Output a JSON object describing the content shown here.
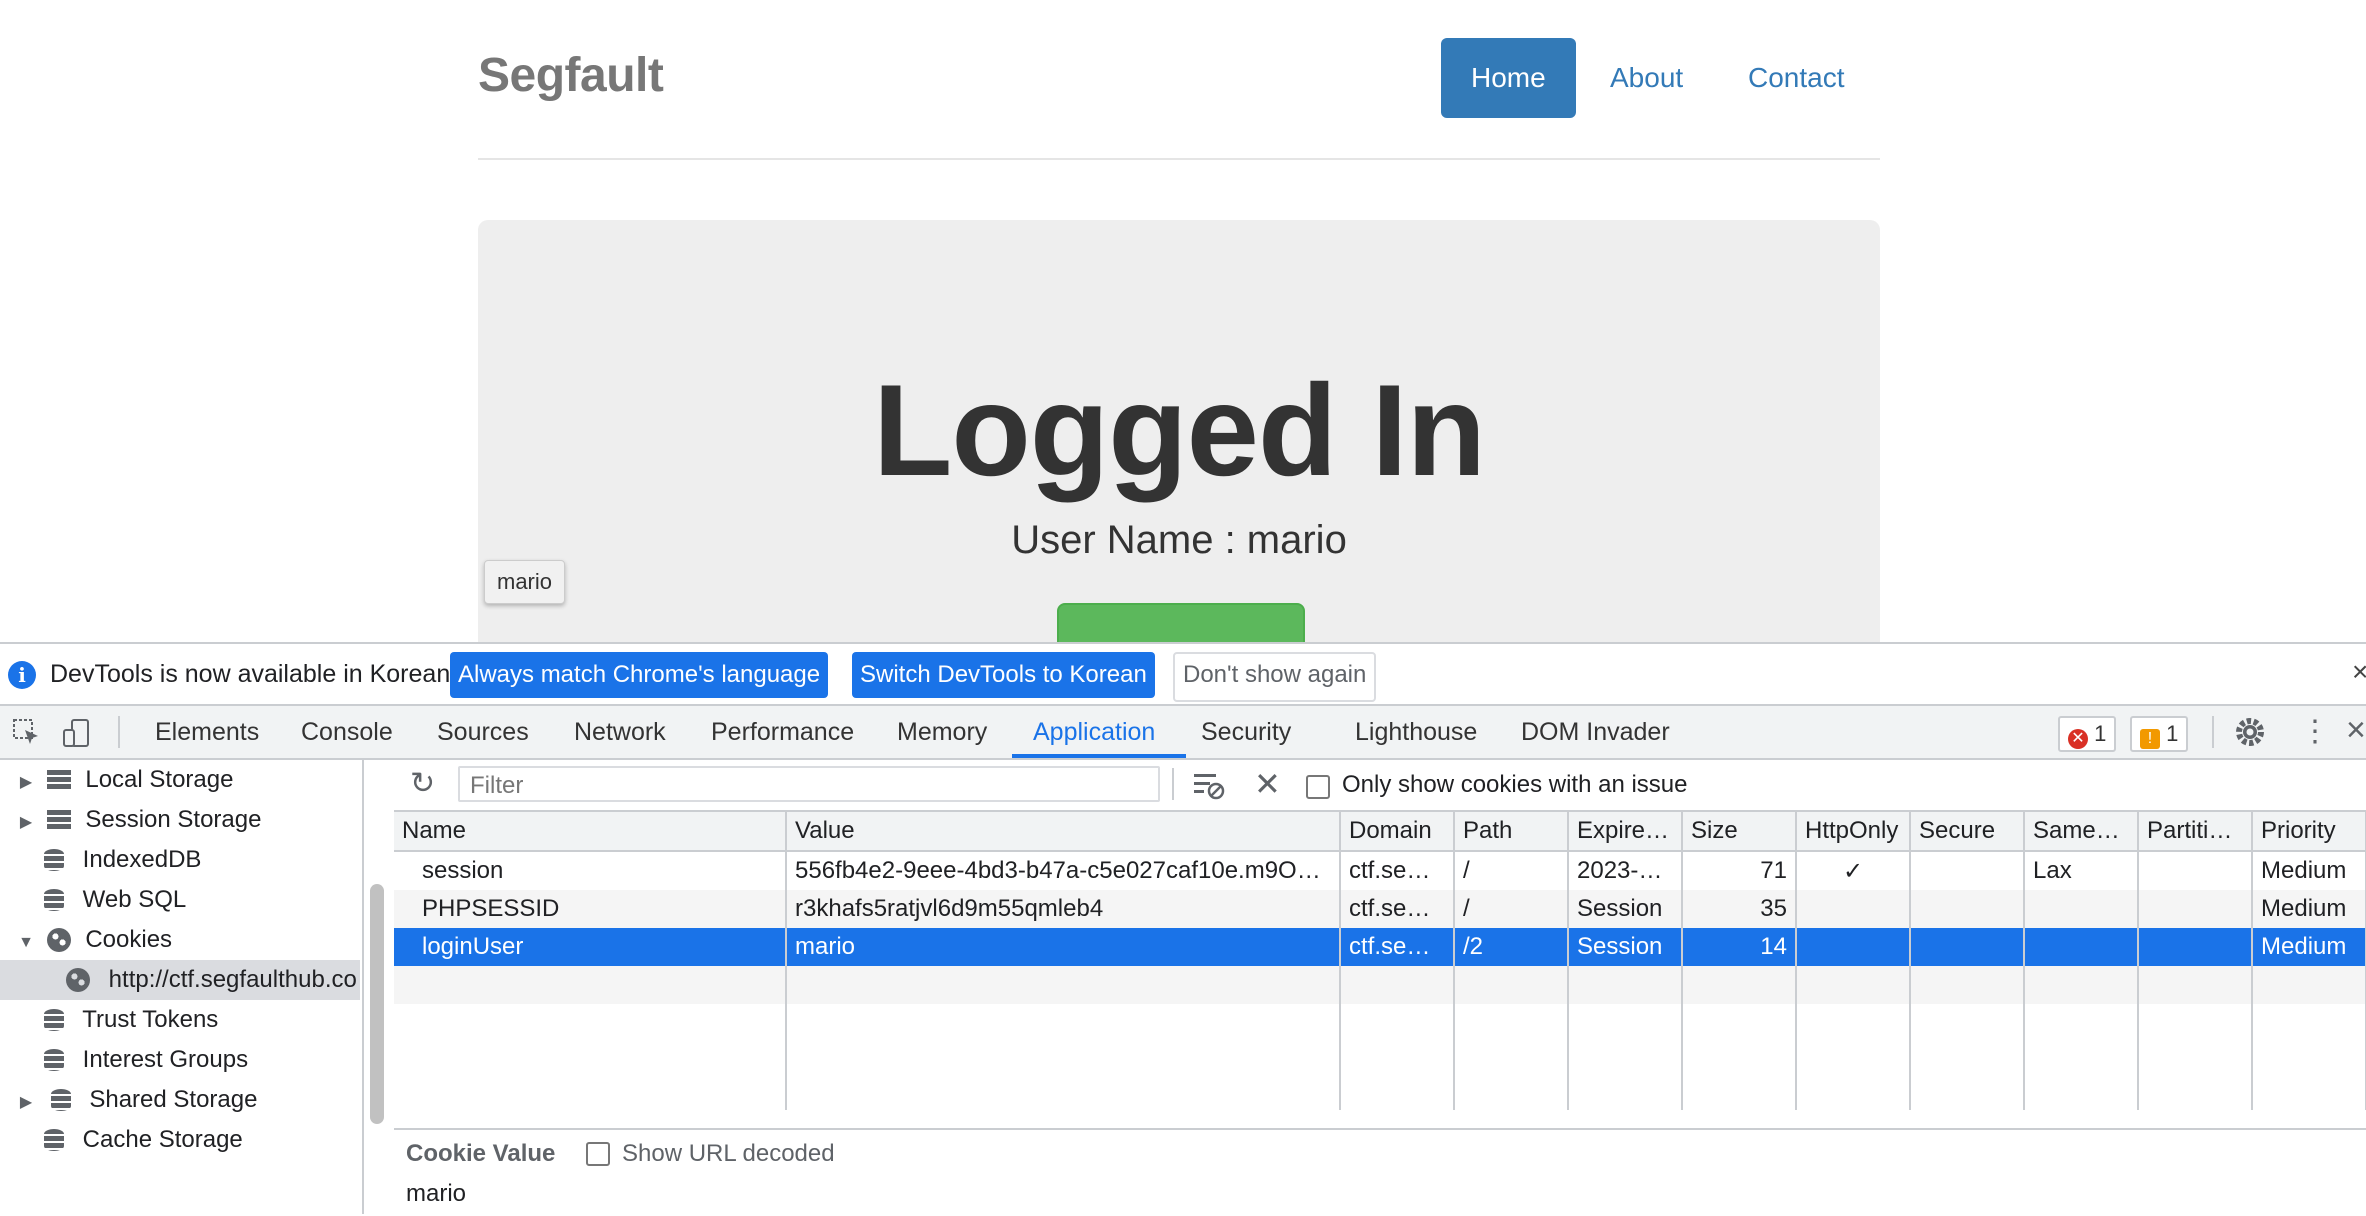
{
  "site": {
    "brand": "Segfault",
    "nav": [
      "Home",
      "About",
      "Contact"
    ],
    "heading": "Logged In",
    "user_line": "User Name : mario",
    "tooltip": "mario"
  },
  "devtools": {
    "infobar": {
      "message": "DevTools is now available in Korean!",
      "btn_match": "Always match Chrome's language",
      "btn_switch": "Switch DevTools to Korean",
      "btn_dismiss": "Don't show again",
      "close": "×"
    },
    "tabs": [
      "Elements",
      "Console",
      "Sources",
      "Network",
      "Performance",
      "Memory",
      "Application",
      "Security",
      "Lighthouse",
      "DOM Invader"
    ],
    "errors": "1",
    "warnings": "1",
    "sidebar": [
      {
        "label": "Local Storage",
        "expand": "▶"
      },
      {
        "label": "Session Storage",
        "expand": "▶"
      },
      {
        "label": "IndexedDB",
        "expand": ""
      },
      {
        "label": "Web SQL",
        "expand": ""
      },
      {
        "label": "Cookies",
        "expand": "▼"
      },
      {
        "label": "http://ctf.segfaulthub.co",
        "expand": ""
      },
      {
        "label": "Trust Tokens",
        "expand": ""
      },
      {
        "label": "Interest Groups",
        "expand": ""
      },
      {
        "label": "Shared Storage",
        "expand": "▶"
      },
      {
        "label": "Cache Storage",
        "expand": ""
      }
    ],
    "toolbar": {
      "filter_placeholder": "Filter",
      "only_issues": "Only show cookies with an issue"
    },
    "columns": [
      "Name",
      "Value",
      "Domain",
      "Path",
      "Expire…",
      "Size",
      "HttpOnly",
      "Secure",
      "Same…",
      "Partiti…",
      "Priority"
    ],
    "rows": [
      [
        "session",
        "556fb4e2-9eee-4bd3-b47a-c5e027caf10e.m9O…",
        "ctf.se…",
        "/",
        "2023-…",
        "71",
        "✓",
        "",
        "Lax",
        "",
        "Medium"
      ],
      [
        "PHPSESSID",
        "r3khafs5ratjvl6d9m55qmleb4",
        "ctf.se…",
        "/",
        "Session",
        "35",
        "",
        "",
        "",
        "",
        "Medium"
      ],
      [
        "loginUser",
        "mario",
        "ctf.se…",
        "/2",
        "Session",
        "14",
        "",
        "",
        "",
        "",
        "Medium"
      ]
    ],
    "detail": {
      "title": "Cookie Value",
      "show_decoded": "Show URL decoded",
      "value": "mario"
    }
  }
}
